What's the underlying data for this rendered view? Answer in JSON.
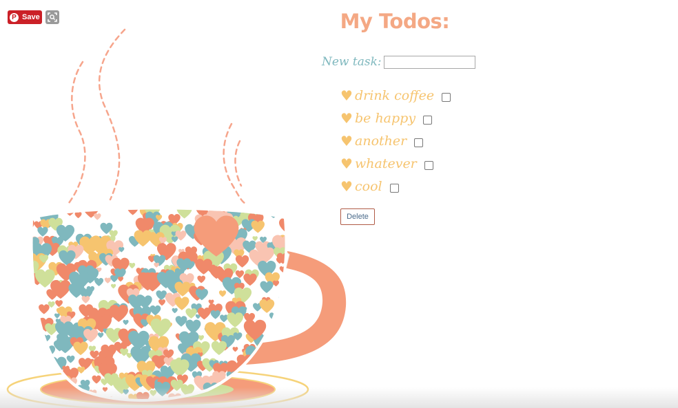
{
  "pinterest": {
    "save_label": "Save",
    "brand_color": "#cb2027"
  },
  "title": "My Todos:",
  "new_task": {
    "label": "New task:",
    "value": "",
    "placeholder": ""
  },
  "todos": [
    {
      "label": "drink coffee",
      "checked": false
    },
    {
      "label": "be happy",
      "checked": false
    },
    {
      "label": "another",
      "checked": false
    },
    {
      "label": "whatever",
      "checked": false
    },
    {
      "label": "cool",
      "checked": false
    }
  ],
  "delete_label": "Delete",
  "colors": {
    "title": "#f4a884",
    "label": "#7fb8be",
    "todo": "#f6c46f",
    "heart_teal": "#7fb8be",
    "heart_coral": "#f0896a",
    "heart_yellow": "#f6c46f",
    "heart_green": "#cfe09a",
    "heart_pink": "#f9c4b2",
    "cup_handle": "#f59c7a",
    "saucer_rim": "#f6d37a"
  }
}
